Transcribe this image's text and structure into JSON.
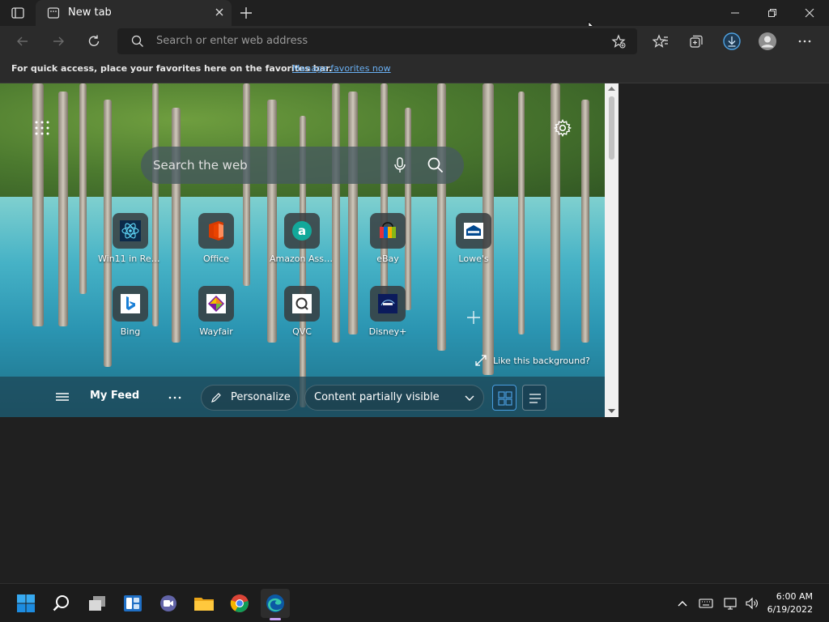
{
  "browser": {
    "tab_title": "New tab",
    "address_placeholder": "Search or enter web address"
  },
  "favorites_bar": {
    "message": "For quick access, place your favorites here on the favorites bar.",
    "link": "Manage favorites now"
  },
  "newtab": {
    "search_placeholder": "Search the web",
    "tiles": [
      {
        "label": "Win11 in React",
        "icon": "react-icon"
      },
      {
        "label": "Office",
        "icon": "office-icon"
      },
      {
        "label": "Amazon Assi...",
        "icon": "amazon-icon"
      },
      {
        "label": "eBay",
        "icon": "ebay-icon"
      },
      {
        "label": "Lowe's",
        "icon": "lowes-icon"
      },
      {
        "label": "Bing",
        "icon": "bing-icon"
      },
      {
        "label": "Wayfair",
        "icon": "wayfair-icon"
      },
      {
        "label": "QVC",
        "icon": "qvc-icon"
      },
      {
        "label": "Disney+",
        "icon": "disney-icon"
      }
    ],
    "like_background": "Like this background?",
    "feed": {
      "title": "My Feed",
      "personalize": "Personalize",
      "content_visibility": "Content partially visible"
    }
  },
  "taskbar": {
    "time": "6:00 AM",
    "date": "6/19/2022"
  },
  "colors": {
    "accent": "#0078d4",
    "link": "#6ab0f3",
    "frame": "#202020"
  }
}
